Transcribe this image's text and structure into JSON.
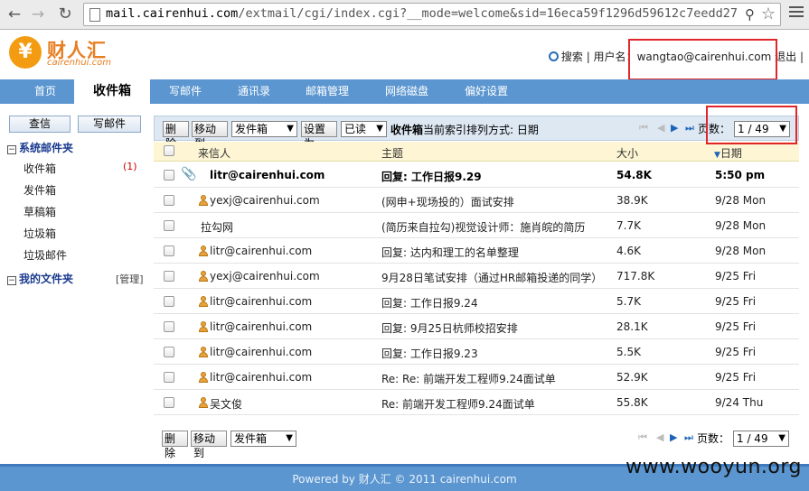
{
  "browser": {
    "url_host": "mail.cairenhui.com",
    "url_rest": "/extmail/cgi/index.cgi?__mode=welcome&sid=16eca59f1296d59612c7eedd27f"
  },
  "header": {
    "logo_symbol": "¥",
    "logo_name": "财人汇",
    "logo_domain": "cairenhui.com",
    "search_link": "搜索",
    "sep1": " | ",
    "user_label": "用户名：",
    "username": "wangtao@cairenhui.com",
    "logout_link": "退出",
    "sep2": " |"
  },
  "tabs": [
    {
      "label": "首页",
      "active": false
    },
    {
      "label": "收件箱",
      "active": true
    },
    {
      "label": "写邮件",
      "active": false
    },
    {
      "label": "通讯录",
      "active": false
    },
    {
      "label": "邮箱管理",
      "active": false
    },
    {
      "label": "网络磁盘",
      "active": false
    },
    {
      "label": "偏好设置",
      "active": false
    }
  ],
  "sidebar": {
    "check_button": "查信",
    "compose_button": "写邮件",
    "system_folders_title": "系统邮件夹",
    "folders": [
      {
        "name": "收件箱",
        "count": "(1)"
      },
      {
        "name": "发件箱",
        "count": ""
      },
      {
        "name": "草稿箱",
        "count": ""
      },
      {
        "name": "垃圾箱",
        "count": ""
      },
      {
        "name": "垃圾邮件",
        "count": ""
      }
    ],
    "my_folders_title": "我的文件夹",
    "manage_link": "[管理]"
  },
  "toolbar": {
    "delete_button": "删除",
    "move_button": "移动到",
    "move_target": "发件箱",
    "setas_button": "设置为",
    "setas_value": "已读",
    "sort_folder": "收件箱",
    "sort_text": "当前索引排列方式: 日期",
    "page_label": "页数：",
    "page_value": "1 / 49"
  },
  "table": {
    "columns": {
      "from": "来信人",
      "subject": "主题",
      "size": "大小",
      "date": "日期"
    },
    "rows": [
      {
        "from": "litr@cairenhui.com",
        "subject": "回复: 工作日报9.29",
        "size": "54.8K",
        "date": "5:50 pm",
        "unread": true,
        "attachment": true,
        "contact": false
      },
      {
        "from": "yexj@cairenhui.com",
        "subject": "(网申+现场投的）面试安排",
        "size": "38.9K",
        "date": "9/28 Mon",
        "unread": false,
        "attachment": false,
        "contact": true
      },
      {
        "from": "拉勾网",
        "subject": "(简历来自拉勾)视觉设计师：施肖皖的简历",
        "size": "7.7K",
        "date": "9/28 Mon",
        "unread": false,
        "attachment": false,
        "contact": false
      },
      {
        "from": "litr@cairenhui.com",
        "subject": "回复: 达内和理工的名单整理",
        "size": "4.6K",
        "date": "9/28 Mon",
        "unread": false,
        "attachment": false,
        "contact": true
      },
      {
        "from": "yexj@cairenhui.com",
        "subject": "9月28日笔试安排（通过HR邮箱投递的同学）",
        "size": "717.8K",
        "date": "9/25 Fri",
        "unread": false,
        "attachment": false,
        "contact": true
      },
      {
        "from": "litr@cairenhui.com",
        "subject": "回复: 工作日报9.24",
        "size": "5.7K",
        "date": "9/25 Fri",
        "unread": false,
        "attachment": false,
        "contact": true
      },
      {
        "from": "litr@cairenhui.com",
        "subject": "回复: 9月25日杭师校招安排",
        "size": "28.1K",
        "date": "9/25 Fri",
        "unread": false,
        "attachment": false,
        "contact": true
      },
      {
        "from": "litr@cairenhui.com",
        "subject": "回复: 工作日报9.23",
        "size": "5.5K",
        "date": "9/25 Fri",
        "unread": false,
        "attachment": false,
        "contact": true
      },
      {
        "from": "litr@cairenhui.com",
        "subject": "Re: Re: 前端开发工程师9.24面试单",
        "size": "52.9K",
        "date": "9/25 Fri",
        "unread": false,
        "attachment": false,
        "contact": true
      },
      {
        "from": "吴文俊",
        "subject": "Re: 前端开发工程师9.24面试单",
        "size": "55.8K",
        "date": "9/24 Thu",
        "unread": false,
        "attachment": false,
        "contact": true
      }
    ]
  },
  "footer": {
    "text": "Powered by 财人汇 © 2011 cairenhui.com",
    "watermark": "www.wooyun.org"
  },
  "colors": {
    "nav_blue": "#5b96d0",
    "highlight_red": "#e0262b",
    "brand_orange": "#f39c12"
  }
}
